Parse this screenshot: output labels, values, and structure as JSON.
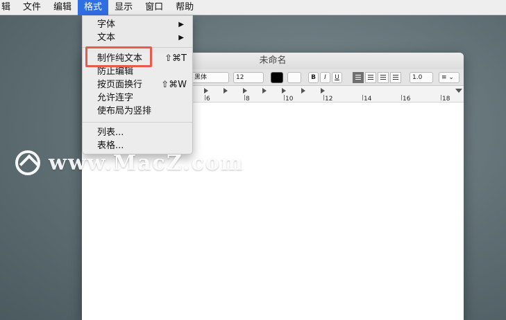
{
  "menubar": {
    "items": [
      {
        "label": "辑"
      },
      {
        "label": "文件"
      },
      {
        "label": "编辑"
      },
      {
        "label": "格式"
      },
      {
        "label": "显示"
      },
      {
        "label": "窗口"
      },
      {
        "label": "帮助"
      }
    ],
    "active_index": 3
  },
  "window": {
    "title": "未命名",
    "toolbar": {
      "font_value": "黑体",
      "size_value": "12",
      "bold": "B",
      "italic": "I",
      "underline": "U",
      "spacing_value": "1.0"
    },
    "ruler": {
      "numbers": [
        "6",
        "8",
        "10",
        "12",
        "14",
        "16",
        "18"
      ]
    }
  },
  "format_menu": {
    "items": [
      {
        "label": "字体",
        "has_submenu": true
      },
      {
        "label": "文本",
        "has_submenu": true
      },
      {
        "label": "制作纯文本",
        "shortcut": "⇧⌘T"
      },
      {
        "label": "防止编辑"
      },
      {
        "label": "按页面换行",
        "shortcut": "⇧⌘W"
      },
      {
        "label": "允许连字"
      },
      {
        "label": "使布局为竖排"
      },
      {
        "label": "列表..."
      },
      {
        "label": "表格..."
      }
    ]
  },
  "watermark": {
    "text": "www.MacZ.com"
  },
  "colors": {
    "accent": "#2f6fe4",
    "highlight_box": "#ea5a4c"
  }
}
